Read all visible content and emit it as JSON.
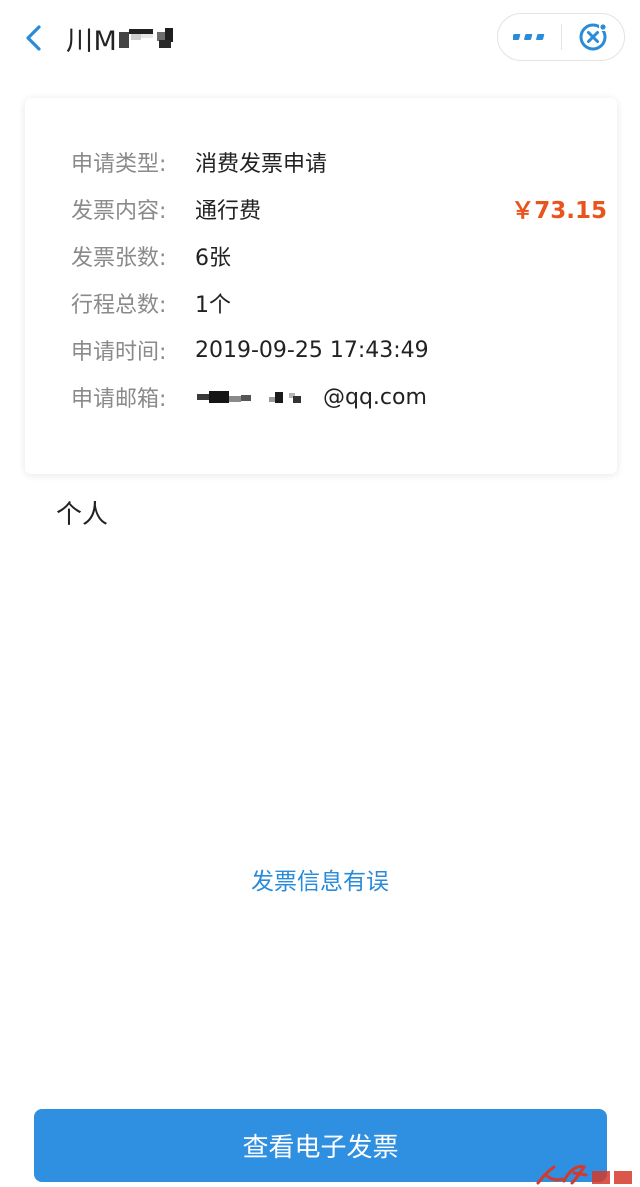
{
  "header": {
    "title": "川M",
    "back_icon": "chevron-left-icon",
    "more_icon": "more-dots-icon",
    "close_icon": "close-target-icon"
  },
  "card": {
    "rows": [
      {
        "label": "申请类型:",
        "value": "消费发票申请"
      },
      {
        "label": "发票内容:",
        "value": "通行费"
      },
      {
        "label": "发票张数:",
        "value": "6张"
      },
      {
        "label": "行程总数:",
        "value": "1个"
      },
      {
        "label": "申请时间:",
        "value": "2019-09-25 17:43:49"
      },
      {
        "label": "申请邮箱:",
        "value": "@qq.com"
      }
    ],
    "amount": "￥73.15"
  },
  "invoice_title_type": "个人",
  "error_link": "发票信息有误",
  "view_button": "查看电子发票",
  "colors": {
    "accent": "#2f8fe0",
    "link": "#2a8bd8",
    "amount": "#e8541e",
    "label": "#8a8a8a"
  }
}
